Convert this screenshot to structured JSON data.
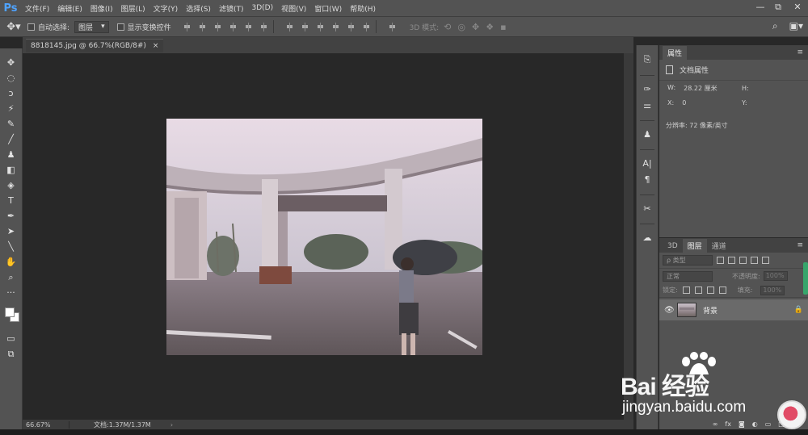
{
  "app": {
    "logo": "Ps",
    "menu": [
      "文件(F)",
      "编辑(E)",
      "图像(I)",
      "图层(L)",
      "文字(Y)",
      "选择(S)",
      "滤镜(T)",
      "3D(D)",
      "视图(V)",
      "窗口(W)",
      "帮助(H)"
    ],
    "window_controls": [
      "—",
      "⧉",
      "✕"
    ]
  },
  "options": {
    "auto_select_label": "自动选择:",
    "auto_select_value": "图层",
    "show_transform_label": "显示变换控件",
    "mode_3d_label": "3D 模式:"
  },
  "document": {
    "tab_title": "8818145.jpg @ 66.7%(RGB/8#)",
    "close": "×",
    "zoom": "66.67%",
    "doc_info": "文档:1.37M/1.37M",
    "status_arrow": "›"
  },
  "properties": {
    "tab": "属性",
    "title": "文档属性",
    "w_label": "W:",
    "w_value": "28.22 厘米",
    "h_label": "H:",
    "h_value": "",
    "x_label": "X:",
    "x_value": "0",
    "y_label": "Y:",
    "y_value": "",
    "resolution": "分辨率: 72 像素/英寸"
  },
  "layers": {
    "tabs": [
      "3D",
      "图层",
      "通道"
    ],
    "kind_placeholder": "ρ 类型",
    "blend_mode": "正常",
    "opacity_label": "不透明度:",
    "opacity_value": "100%",
    "lock_label": "锁定:",
    "fill_label": "填充:",
    "fill_value": "100%",
    "items": [
      {
        "name": "背景",
        "visible": true,
        "locked": true
      }
    ]
  },
  "watermark": {
    "logo": "Bai  经验",
    "url": "jingyan.baidu.com"
  },
  "colors": {
    "ps_blue": "#4fa3ff",
    "panel_bg": "#535353",
    "canvas_bg": "#282828"
  }
}
